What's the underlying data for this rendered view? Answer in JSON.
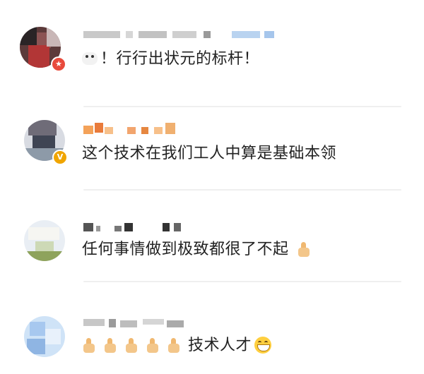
{
  "comments": [
    {
      "text": "！行行出状元的标杆！",
      "leading_emoji": "cow-face-icon",
      "verified": "badge-red"
    },
    {
      "text": "这个技术在我们工人中算是基础本领",
      "verified": "badge-gold"
    },
    {
      "text": "任何事情做到极致都很了不起",
      "trailing_emoji": "thumbs-up-icon"
    },
    {
      "text": "技术人才",
      "leading_emoji": "thumbs-up-icon",
      "leading_emoji_count": 5,
      "trailing_emoji": "grinning-face-icon"
    }
  ],
  "colors": {
    "badge_red": "#e84a3c",
    "badge_gold": "#f0a500",
    "divider": "#efefef",
    "text": "#222222"
  }
}
